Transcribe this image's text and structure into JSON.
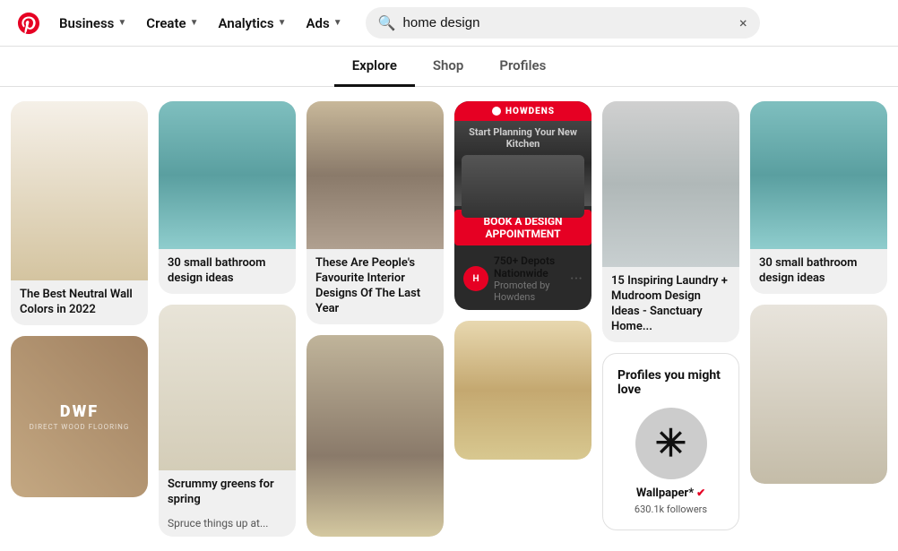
{
  "header": {
    "logo_label": "Pinterest",
    "nav": [
      {
        "label": "Business",
        "has_chevron": true
      },
      {
        "label": "Create",
        "has_chevron": true
      },
      {
        "label": "Analytics",
        "has_chevron": true
      },
      {
        "label": "Ads",
        "has_chevron": true
      }
    ],
    "search_value": "home design",
    "search_placeholder": "Search",
    "close_icon": "×"
  },
  "tabs": [
    {
      "label": "Explore",
      "active": true
    },
    {
      "label": "Shop",
      "active": false
    },
    {
      "label": "Profiles",
      "active": false
    }
  ],
  "pins": [
    {
      "id": "hallway",
      "type": "image_text",
      "text": "The Best Neutral Wall Colors in 2022",
      "image_class": "block-light-hallway"
    },
    {
      "id": "teal-bath-1",
      "type": "image_text",
      "text": "30 small bathroom design ideas",
      "image_class": "block-teal-bath"
    },
    {
      "id": "kitchen-stone",
      "type": "image_text",
      "text": "These Are People's Favourite Interior Designs Of The Last Year",
      "image_class": "block-kitchen-stone"
    },
    {
      "id": "howdens-promo",
      "type": "promoted",
      "brand": "Howdens",
      "brand_short": "H",
      "headline": "Start Planning Your New Kitchen",
      "sub_headline": "750+ Depots Nationwide",
      "promoted_by": "Promoted by",
      "promoted_name": "Howdens",
      "cta": "BOOK A DESIGN APPOINTMENT"
    },
    {
      "id": "grey-kitchen",
      "type": "image_text",
      "text": "15 Inspiring Laundry + Mudroom Design Ideas - Sanctuary Home...",
      "image_class": "block-grey-kitchen"
    },
    {
      "id": "teal-bath-2",
      "type": "image_text",
      "text": "30 small bathroom design ideas",
      "image_class": "block-teal-bath2"
    },
    {
      "id": "dwf",
      "type": "logo",
      "image_class": "block-dwf",
      "logo_text": "DWF",
      "logo_sub": "DIRECT WOOD FLOORING"
    },
    {
      "id": "green-sofa",
      "type": "image_text",
      "text": "Scrummy greens for spring",
      "subtext": "Spruce things up at...",
      "image_class": "block-green-sofa"
    },
    {
      "id": "stairs-library",
      "type": "image_only",
      "image_class": "block-stairs"
    },
    {
      "id": "pendant-light",
      "type": "image_only",
      "image_class": "block-pendant"
    },
    {
      "id": "profiles-card",
      "type": "profiles",
      "title": "Profiles you might love",
      "profile": {
        "name": "Wallpaper*",
        "verified": true,
        "followers": "630.1k followers"
      }
    },
    {
      "id": "living-room",
      "type": "image_only",
      "image_class": "block-living"
    }
  ]
}
